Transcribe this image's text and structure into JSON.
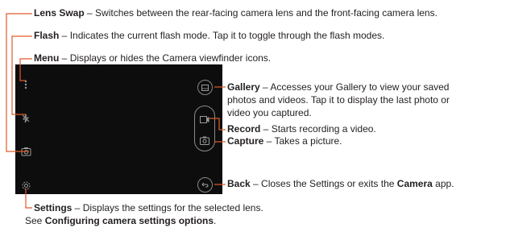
{
  "annotations": {
    "lens_swap": {
      "title": "Lens Swap",
      "sep": " – ",
      "desc": "Switches between the rear-facing camera lens and the front-facing camera lens."
    },
    "flash": {
      "title": "Flash",
      "sep": " – ",
      "desc": "Indicates the current flash mode. Tap it to toggle through the flash modes."
    },
    "menu": {
      "title": "Menu",
      "sep": " – ",
      "desc": "Displays or hides the Camera viewfinder icons."
    },
    "gallery": {
      "title": "Gallery",
      "sep": " – ",
      "desc_line1": "Accesses your Gallery to view your saved",
      "desc_line2": "photos and videos. Tap it to display the last photo or",
      "desc_line3": "video you captured."
    },
    "record": {
      "title": "Record",
      "sep": " – ",
      "desc": "Starts recording a video."
    },
    "capture": {
      "title": "Capture",
      "sep": " – ",
      "desc": "Takes a picture."
    },
    "back": {
      "title": "Back",
      "sep": " – ",
      "desc_pre": "Closes the Settings or exits the ",
      "desc_bold": "Camera",
      "desc_post": " app."
    },
    "settings": {
      "title": "Settings",
      "sep": " – ",
      "desc_line1": "Displays the settings for the selected lens.",
      "desc_line2_pre": "See ",
      "desc_line2_bold": "Configuring camera settings options",
      "desc_line2_post": "."
    }
  },
  "icons": {
    "menu": "menu-dots-icon",
    "flash": "flash-off-icon",
    "lens_swap": "lens-swap-icon",
    "settings": "gear-icon",
    "gallery": "gallery-icon",
    "record": "video-record-icon",
    "capture": "camera-capture-icon",
    "back": "back-arrow-icon"
  },
  "colors": {
    "viewfinder": "#0d0d0d",
    "callout_line": "#e05a2a",
    "icon": "#9a9a9a"
  }
}
